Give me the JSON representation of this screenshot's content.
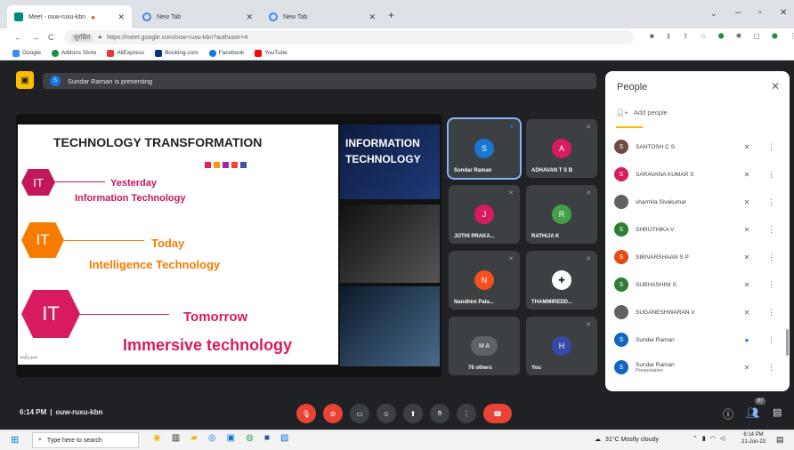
{
  "browser": {
    "tabs": [
      {
        "title": "Meet - ouw-ruxu-kbn",
        "active": true
      },
      {
        "title": "New Tab",
        "active": false
      },
      {
        "title": "New Tab",
        "active": false
      }
    ],
    "url_prefix": "सुरक्षित",
    "url": "https://meet.google.com/ouw-ruxu-kbn?authuser=4",
    "bookmarks": [
      "Google",
      "Addons Store",
      "AliExpress",
      "Booking.com",
      "Facebook",
      "YouTube"
    ]
  },
  "meet": {
    "presenting_banner": "Sundar Raman is presenting",
    "presenter_initial": "S",
    "time": "6:14 PM",
    "separator": "|",
    "meeting_code": "ouw-ruxu-kbn",
    "participant_count": "87"
  },
  "slide": {
    "title": "TECHNOLOGY TRANSFORMATION",
    "right_title_line1": "INFORMATION",
    "right_title_line2": "TECHNOLOGY",
    "items": [
      {
        "badge": "IT",
        "label1": "Yesterday",
        "label2": "Information Technology",
        "color": "#c2185b"
      },
      {
        "badge": "IT",
        "label1": "Today",
        "label2": "Intelligence Technology",
        "color": "#f57c00"
      },
      {
        "badge": "IT",
        "label1": "Tomorrow",
        "label2": "Immersive technology",
        "color": "#d81b60"
      }
    ]
  },
  "tiles": [
    {
      "initial": "S",
      "name": "Sundar Raman",
      "color": "#1976d2"
    },
    {
      "initial": "A",
      "name": "ADHAVAN T S B",
      "color": "#d81b60"
    },
    {
      "initial": "J",
      "name": "JOTHI PRAKA...",
      "color": "#d81b60"
    },
    {
      "initial": "R",
      "name": "RATHIJA K",
      "color": "#43a047"
    },
    {
      "initial": "N",
      "name": "Nandhini Pala...",
      "color": "#f4511e"
    },
    {
      "initial": "",
      "name": "THAMMIREDD...",
      "color": "#ffffff"
    },
    {
      "initial": "M A",
      "name": "76 others",
      "color": "#4caf50"
    },
    {
      "initial": "H",
      "name": "You",
      "color": "#3949ab"
    }
  ],
  "people_panel": {
    "title": "People",
    "add_label": "Add people",
    "rows": [
      {
        "initial": "S",
        "name": "SANTOSH C S",
        "color": "#6d4c41",
        "sub": ""
      },
      {
        "initial": "S",
        "name": "SARAVANA KUMAR S",
        "color": "#d81b60",
        "sub": ""
      },
      {
        "initial": "",
        "name": "sharmila Sivakumar",
        "color": "#616161",
        "sub": ""
      },
      {
        "initial": "S",
        "name": "SHRUTHIKA V",
        "color": "#2e7d32",
        "sub": ""
      },
      {
        "initial": "S",
        "name": "SIBIVARSHAAN S P",
        "color": "#e64a19",
        "sub": ""
      },
      {
        "initial": "S",
        "name": "SUBHASHINI S",
        "color": "#2e7d32",
        "sub": ""
      },
      {
        "initial": "",
        "name": "SUGANESHWARAN V",
        "color": "#616161",
        "sub": ""
      },
      {
        "initial": "S",
        "name": "Sundar Raman",
        "color": "#1565c0",
        "sub": ""
      },
      {
        "initial": "S",
        "name": "Sundar Raman",
        "color": "#1565c0",
        "sub": "Presentation"
      }
    ]
  },
  "taskbar": {
    "search_placeholder": "Type here to search",
    "weather": "31°C  Mostly cloudy",
    "time": "6:14 PM",
    "date": "21-Jun-23"
  }
}
